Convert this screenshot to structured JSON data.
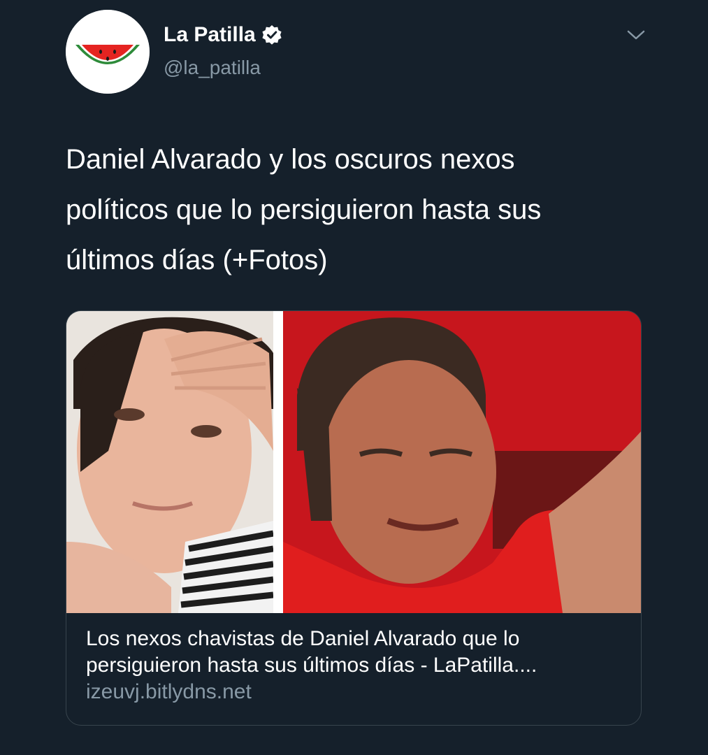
{
  "tweet": {
    "author": {
      "display_name": "La Patilla",
      "handle": "@la_patilla",
      "verified": true,
      "avatar_icon": "watermelon-slice-icon"
    },
    "text": "Daniel Alvarado y los oscuros nexos\npolíticos que lo persiguieron hasta sus\núltimos días (+Fotos)",
    "card": {
      "title": "Los nexos chavistas de Daniel Alvarado que lo\npersiguieron hasta sus últimos días - LaPatilla....",
      "domain": "izeuvj.bitlydns.net"
    }
  },
  "colors": {
    "background": "#15202b",
    "text": "#ffffff",
    "secondary_text": "#8899a6",
    "border": "#38444d",
    "verified_badge": "#ffffff"
  }
}
